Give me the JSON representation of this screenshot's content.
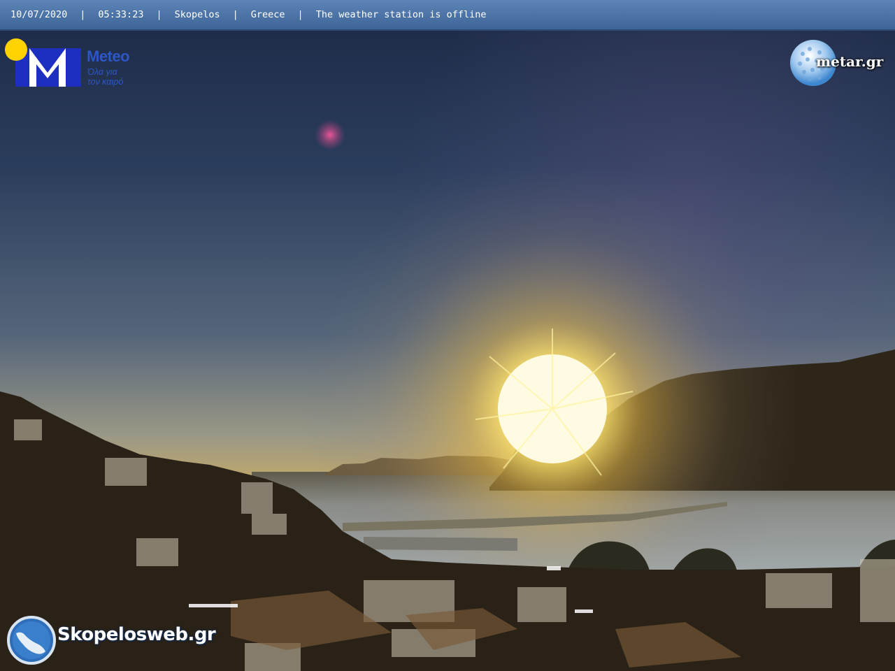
{
  "status_bar": {
    "date": "10/07/2020",
    "time": "05:33:23",
    "location": "Skopelos",
    "country": "Greece",
    "status": "The weather station is offline",
    "separator": "|"
  },
  "logos": {
    "meteo": {
      "name": "Meteo",
      "tagline_line1": "Όλα για",
      "tagline_line2": "τον καιρό",
      "icon": "meteo-m-logo-icon",
      "brand_color": "#2b57c9",
      "sun_color": "#ffd200"
    },
    "metar": {
      "text": "metar.gr",
      "icon": "golf-ball-globe-icon"
    },
    "skopelosweb": {
      "text": "Skopelosweb.gr",
      "icon": "island-map-icon"
    }
  },
  "scene": {
    "description_colors": {
      "sky_top": "#1d2b4a",
      "sky_horizon": "#a8a69a",
      "sun": "#fff6b0",
      "sea": "#8e9aa2",
      "hills": "#2c261b"
    }
  }
}
